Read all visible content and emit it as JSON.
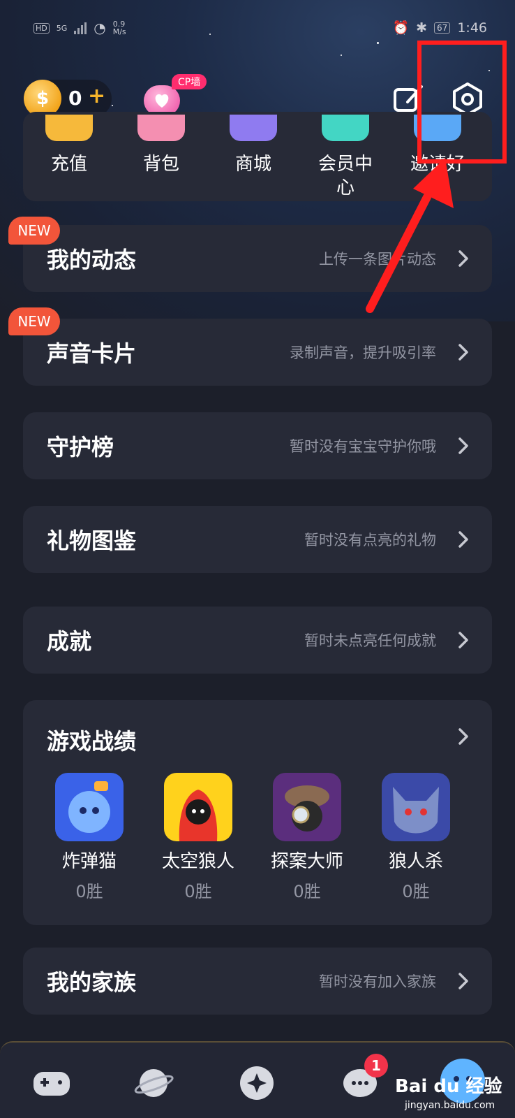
{
  "status_bar": {
    "network_label": "HD",
    "network_gen": "5G",
    "speed_value": "0.9",
    "speed_unit": "M/s",
    "battery": "67",
    "time": "1:46"
  },
  "header": {
    "coin_count": "0",
    "coin_plus": "+",
    "cp_badge": "CP墙"
  },
  "quick_actions": [
    {
      "label": "充值",
      "color": "#f6b93b"
    },
    {
      "label": "背包",
      "color": "#f48fb1"
    },
    {
      "label": "商城",
      "color": "#8f7bf0"
    },
    {
      "label": "会员中\n心",
      "color": "#43d6c4"
    },
    {
      "label": "邀请好\n友",
      "color": "#5aa8f6"
    }
  ],
  "menu_rows": [
    {
      "title": "我的动态",
      "subtitle": "上传一条图片动态",
      "new_badge": "NEW"
    },
    {
      "title": "声音卡片",
      "subtitle": "录制声音，提升吸引率",
      "new_badge": "NEW"
    },
    {
      "title": "守护榜",
      "subtitle": "暂时没有宝宝守护你哦"
    },
    {
      "title": "礼物图鉴",
      "subtitle": "暂时没有点亮的礼物"
    },
    {
      "title": "成就",
      "subtitle": "暂时未点亮任何成就"
    }
  ],
  "games": {
    "title": "游戏战绩",
    "items": [
      {
        "name": "炸弹猫",
        "wins": "0胜",
        "color": "#3a62e8"
      },
      {
        "name": "太空狼人",
        "wins": "0胜",
        "color": "#ffd21c"
      },
      {
        "name": "探案大师",
        "wins": "0胜",
        "color": "#5b2e7d"
      },
      {
        "name": "狼人杀",
        "wins": "0胜",
        "color": "#3b4aa8"
      }
    ]
  },
  "family": {
    "title": "我的家族",
    "subtitle": "暂时没有加入家族"
  },
  "bottom_nav": {
    "message_badge": "1",
    "tabs": [
      "gamepad-icon",
      "planet-icon",
      "sparkle-icon",
      "chat-icon",
      "profile-icon"
    ]
  },
  "watermark": {
    "text": "Bai du 经验",
    "url": "jingyan.baidu.com"
  }
}
